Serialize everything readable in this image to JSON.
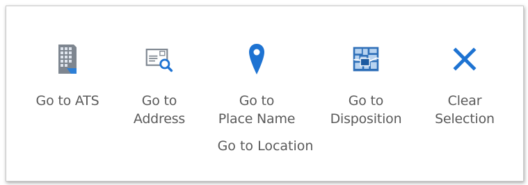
{
  "ribbon": {
    "group_label": "Go to Location",
    "buttons": [
      {
        "line1": "Go to ATS",
        "line2": "",
        "icon": "ats-grid-icon"
      },
      {
        "line1": "Go to",
        "line2": "Address",
        "icon": "address-search-icon"
      },
      {
        "line1": "Go to",
        "line2": "Place Name",
        "icon": "map-pin-icon"
      },
      {
        "line1": "Go to",
        "line2": "Disposition",
        "icon": "disposition-map-icon"
      },
      {
        "line1": "Clear",
        "line2": "Selection",
        "icon": "close-icon"
      }
    ]
  },
  "colors": {
    "accent_blue": "#1e73d2",
    "icon_gray": "#7e8690",
    "label_gray": "#5a5a5a"
  }
}
